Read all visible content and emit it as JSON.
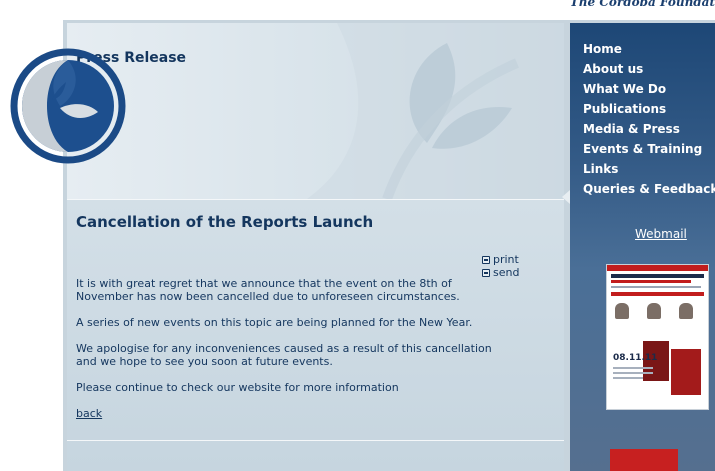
{
  "site": {
    "tagline": "The Cordoba Foundat"
  },
  "header": {
    "title": "Press Release"
  },
  "article": {
    "title": "Cancellation of the Reports Launch",
    "tools": {
      "print": "print",
      "send": "send"
    },
    "paragraphs": [
      "It is with great regret that we announce that the event on the 8th of November has now been cancelled due to unforeseen circumstances.",
      "A series of new events on this topic are being planned for the New Year.",
      "We apologise for any inconveniences caused as a result of this cancellation and we hope to see you soon at future events.",
      "Please continue to check our website for more information"
    ],
    "back": "back"
  },
  "sidebar": {
    "nav": [
      "Home",
      "About us",
      "What We Do",
      "Publications",
      "Media & Press",
      "Events & Training",
      "Links",
      "Queries & Feedback"
    ],
    "webmail": "Webmail",
    "poster": {
      "date": "08.11.11"
    }
  },
  "colors": {
    "brand_navy": "#14365e",
    "sidebar_blue": "#1d4776",
    "accent_red": "#c21d1d"
  },
  "icons": [
    "cordoba-logo-icon",
    "print-icon",
    "send-icon",
    "leaf-watermark-icon"
  ]
}
